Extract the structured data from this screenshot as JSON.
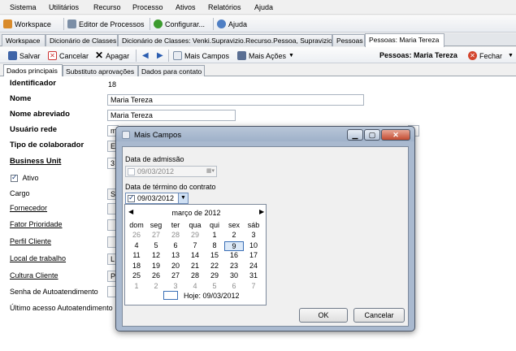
{
  "menu": [
    "Sistema",
    "Utilitários",
    "Recurso",
    "Processo",
    "Ativos",
    "Relatórios",
    "Ajuda"
  ],
  "toolbar": {
    "workspace": "Workspace",
    "editor": "Editor de Processos",
    "configurar": "Configurar...",
    "ajuda": "Ajuda"
  },
  "doc_tabs": [
    "Workspace",
    "Dicionário de Classes",
    "Dicionário de Classes: Venki.Supravizio.Recurso.Pessoa, Supravizio",
    "Pessoas",
    "Pessoas: Maria Tereza"
  ],
  "record_toolbar": {
    "salvar": "Salvar",
    "cancelar": "Cancelar",
    "apagar": "Apagar",
    "mais_campos": "Mais Campos",
    "mais_acoes": "Mais Ações",
    "title": "Pessoas: Maria Tereza",
    "fechar": "Fechar"
  },
  "sub_tabs": [
    "Dados principais",
    "Substituto aprovações",
    "Dados para contato"
  ],
  "form": {
    "identificador_label": "Identificador",
    "identificador_value": "18",
    "nome_label": "Nome",
    "nome_value": "Maria Tereza",
    "nome_abreviado_label": "Nome abreviado",
    "nome_abreviado_value": "Maria Tereza",
    "usuario_label": "Usuário rede",
    "usuario_value": "m",
    "tipo_label": "Tipo de colaborador",
    "tipo_value": "E",
    "bu_label": "Business Unit",
    "bu_value": "3",
    "ativo_label": "Ativo",
    "cargo_label": "Cargo",
    "cargo_value": "Se",
    "fornecedor_label": "Fornecedor",
    "fator_label": "Fator Prioridade",
    "perfil_label": "Perfil Cliente",
    "local_label": "Local de trabalho",
    "local_value": "L",
    "cultura_label": "Cultura Cliente",
    "cultura_value": "P",
    "senha_label": "Senha de Autoatendimento",
    "ultimo_label": "Último acesso Autoatendimento"
  },
  "dialog": {
    "title": "Mais Campos",
    "admissao_label": "Data de admissão",
    "admissao_value": "09/03/2012",
    "termino_label": "Data de término do contrato",
    "termino_value": "09/03/2012",
    "ok": "OK",
    "cancelar": "Cancelar"
  },
  "calendar": {
    "month_label": "março de 2012",
    "weekdays": [
      "dom",
      "seg",
      "ter",
      "qua",
      "qui",
      "sex",
      "sáb"
    ],
    "weeks": [
      [
        "26",
        "27",
        "28",
        "29",
        "1",
        "2",
        "3"
      ],
      [
        "4",
        "5",
        "6",
        "7",
        "8",
        "9",
        "10"
      ],
      [
        "11",
        "12",
        "13",
        "14",
        "15",
        "16",
        "17"
      ],
      [
        "18",
        "19",
        "20",
        "21",
        "22",
        "23",
        "24"
      ],
      [
        "25",
        "26",
        "27",
        "28",
        "29",
        "30",
        "31"
      ],
      [
        "1",
        "2",
        "3",
        "4",
        "5",
        "6",
        "7"
      ]
    ],
    "today_label": "Hoje: 09/03/2012"
  }
}
